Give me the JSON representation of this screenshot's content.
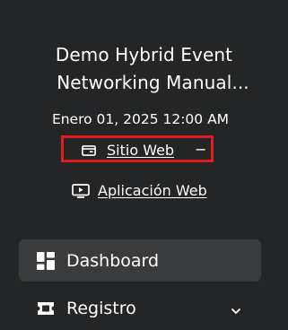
{
  "event": {
    "title_line1": "Demo Hybrid Event",
    "title_line2": "Networking Manual...",
    "date": "Enero 01, 2025 12:00 AM"
  },
  "links": {
    "website": {
      "label": "Sitio Web",
      "icon": "browser-window-icon",
      "collapse_symbol": "−"
    },
    "web_app": {
      "label": "Aplicación Web",
      "icon": "play-screen-icon"
    }
  },
  "sidebar": {
    "items": [
      {
        "label": "Dashboard",
        "icon": "dashboard-icon",
        "active": true
      },
      {
        "label": "Registro",
        "icon": "ticket-icon",
        "expandable": true
      }
    ]
  },
  "colors": {
    "background": "#242526",
    "active_item": "#3a3b3c",
    "highlight_border": "#e11d22",
    "text": "#ffffff"
  }
}
